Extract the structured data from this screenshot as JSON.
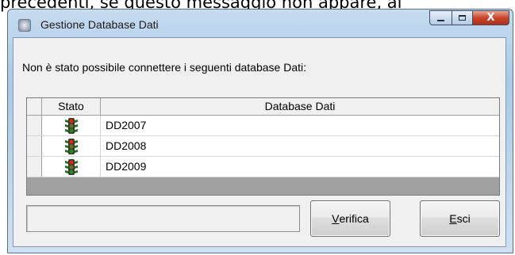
{
  "background_text": "precedenti, se questo messaggio non appare, al",
  "window": {
    "title": "Gestione Database Dati",
    "caption_buttons": {
      "minimize_icon": "minimize-icon",
      "maximize_icon": "maximize-icon",
      "close_icon": "close-icon",
      "close_glyph": "X"
    }
  },
  "message": "Non è stato possibile connettere i seguenti database Dati:",
  "grid": {
    "columns": {
      "stato": "Stato",
      "database": "Database Dati"
    },
    "rows": [
      {
        "status_icon": "traffic-light-red-icon",
        "name": "DD2007"
      },
      {
        "status_icon": "traffic-light-red-icon",
        "name": "DD2008"
      },
      {
        "status_icon": "traffic-light-red-icon",
        "name": "DD2009"
      }
    ]
  },
  "status_field": {
    "value": ""
  },
  "buttons": {
    "verifica": {
      "mnemonic": "V",
      "rest": "erifica"
    },
    "esci": {
      "mnemonic": "E",
      "rest": "sci"
    }
  },
  "colors": {
    "traffic_light_red": "#d8261c",
    "traffic_light_green": "#1f8a2a",
    "close_button": "#c7442a"
  }
}
